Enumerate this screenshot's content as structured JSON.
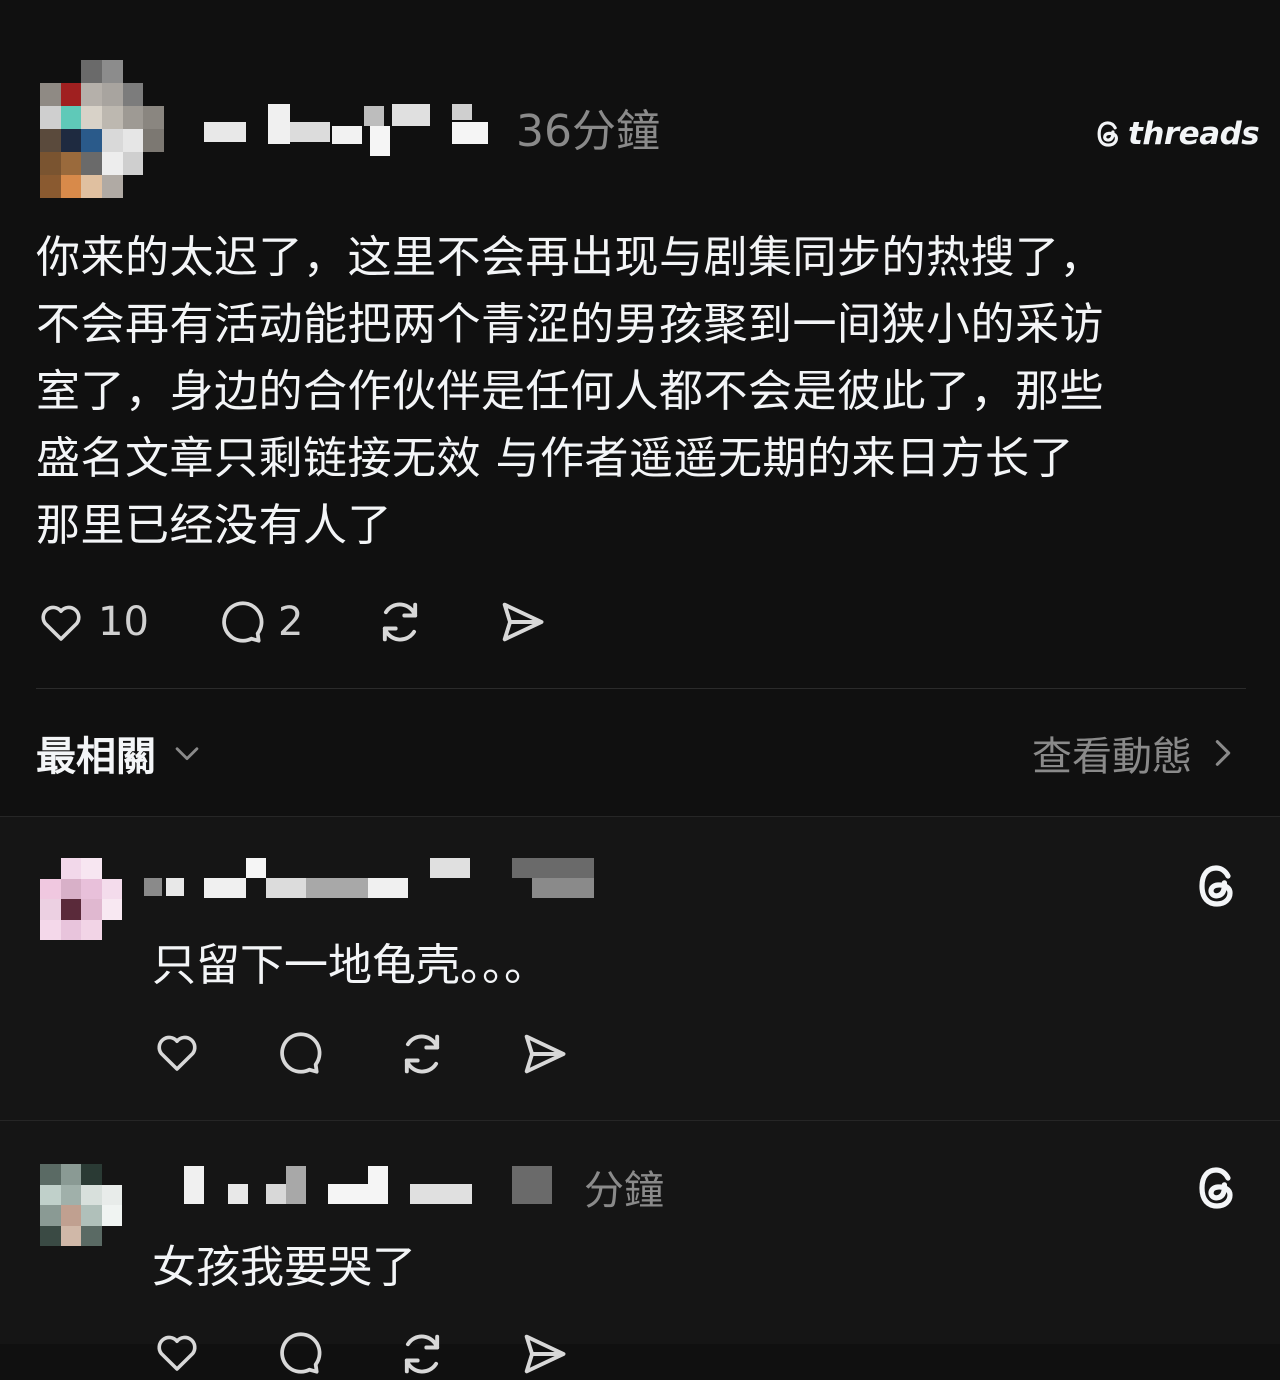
{
  "post": {
    "time_ago": "36分鐘",
    "brand": "threads",
    "text": "你来的太迟了，这里不会再出现与剧集同步的热搜了，\n不会再有活动能把两个青涩的男孩聚到一间狭小的采访\n室了，身边的合作伙伴是任何人都不会是彼此了，那些\n盛名文章只剩链接无效 与作者遥遥无期的来日方长了\n那里已经没有人了",
    "likes": "10",
    "replies": "2"
  },
  "sort": {
    "label": "最相關",
    "view_activity": "查看動態"
  },
  "replies": [
    {
      "time_ago": "",
      "text": "只留下一地龟壳。。。"
    },
    {
      "time_ago": "分鐘",
      "text": "女孩我要哭了"
    }
  ],
  "icons": {
    "like": "heart-icon",
    "reply": "comment-bubble-icon",
    "repost": "repost-arrows-icon",
    "share": "send-paper-plane-icon",
    "logo": "threads-logo-icon",
    "chevron_down": "chevron-down-icon",
    "chevron_right": "chevron-right-icon"
  },
  "colors": {
    "background": "#101010",
    "text": "#f3f5f7",
    "muted": "#8a8a8a",
    "divider": "#2b2b2b"
  }
}
